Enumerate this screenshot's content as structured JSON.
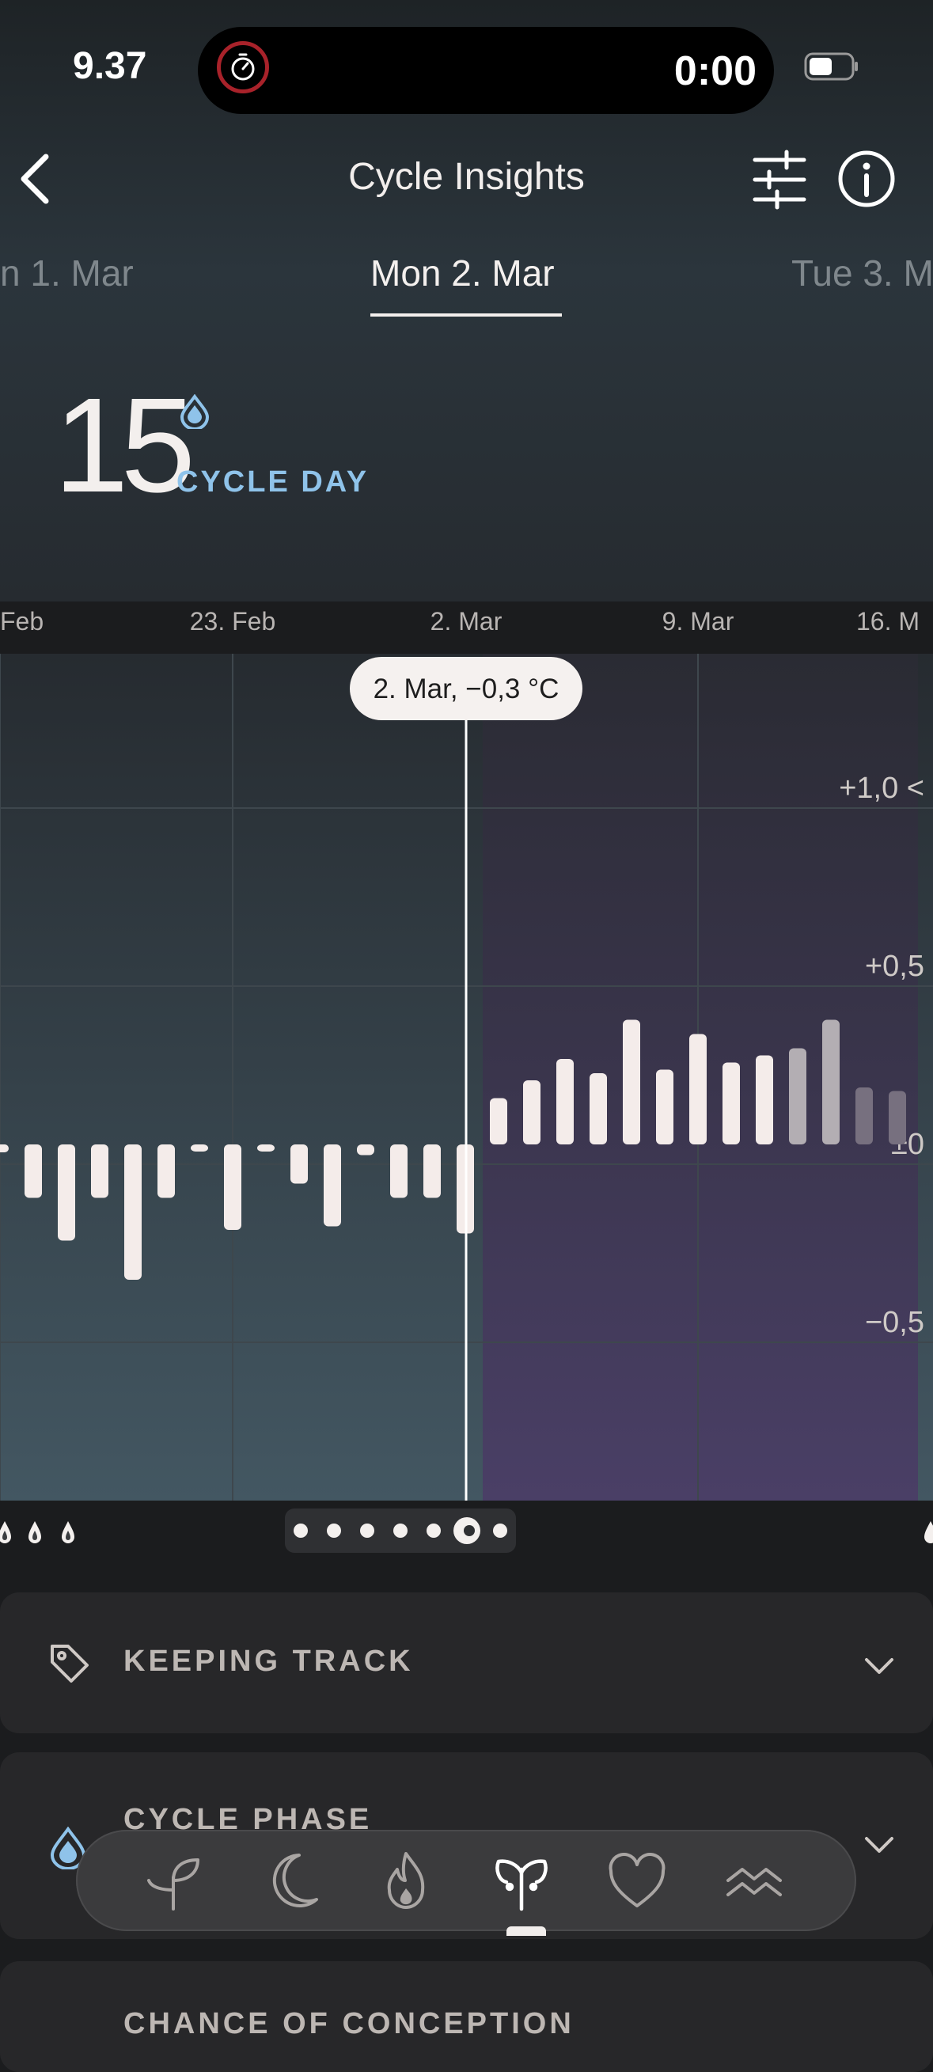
{
  "status_bar": {
    "time": "9.37",
    "timer": "0:00"
  },
  "header": {
    "title": "Cycle Insights"
  },
  "date_tabs": {
    "prev": "n 1. Mar",
    "current": "Mon 2. Mar",
    "next": "Tue 3. M"
  },
  "cycle": {
    "day": "15",
    "label": "CYCLE DAY"
  },
  "colors": {
    "accent_blue": "#8fc3ea",
    "follicular_phase_bg": "#3d4f58",
    "luteal_phase_bg": "#3e3a5a",
    "bar": "#f4ecea"
  },
  "chart_data": {
    "type": "bar",
    "x_tick_labels": [
      "Feb",
      "23. Feb",
      "2. Mar",
      "9. Mar",
      "16. M"
    ],
    "y_tick_labels": [
      "+1,0 <",
      "+0,5",
      "±0",
      "−0,5"
    ],
    "ylim": [
      -1.0,
      1.1
    ],
    "tooltip": "2. Mar, −0,3 °C",
    "selected_index": 14,
    "grid": true,
    "values": [
      -0.15,
      -0.27,
      -0.15,
      -0.38,
      -0.15,
      -0.02,
      -0.24,
      -0.02,
      -0.11,
      -0.23,
      -0.03,
      -0.15,
      -0.15,
      -0.25,
      0.13,
      0.18,
      0.24,
      0.2,
      0.35,
      0.21,
      0.31,
      0.23,
      0.25,
      0.27,
      0.35,
      0.16,
      0.15
    ],
    "estimated_from_index": 23
  },
  "icons": {
    "period_drops": [
      "drop-icon",
      "drop-icon",
      "drop-icon"
    ],
    "bottom_tabs": [
      "sprout-icon",
      "moon-icon",
      "flame-icon",
      "ovary-icon",
      "heart-icon",
      "waves-icon"
    ]
  },
  "page_indicator": {
    "count": 7,
    "active": 5
  },
  "cards": [
    {
      "title": "KEEPING TRACK",
      "icon": "tag-icon"
    },
    {
      "title": "CYCLE PHASE",
      "icon": "drop-icon"
    },
    {
      "title": "CHANCE OF CONCEPTION",
      "icon": ""
    }
  ],
  "bottom_nav": {
    "active_index": 3
  }
}
